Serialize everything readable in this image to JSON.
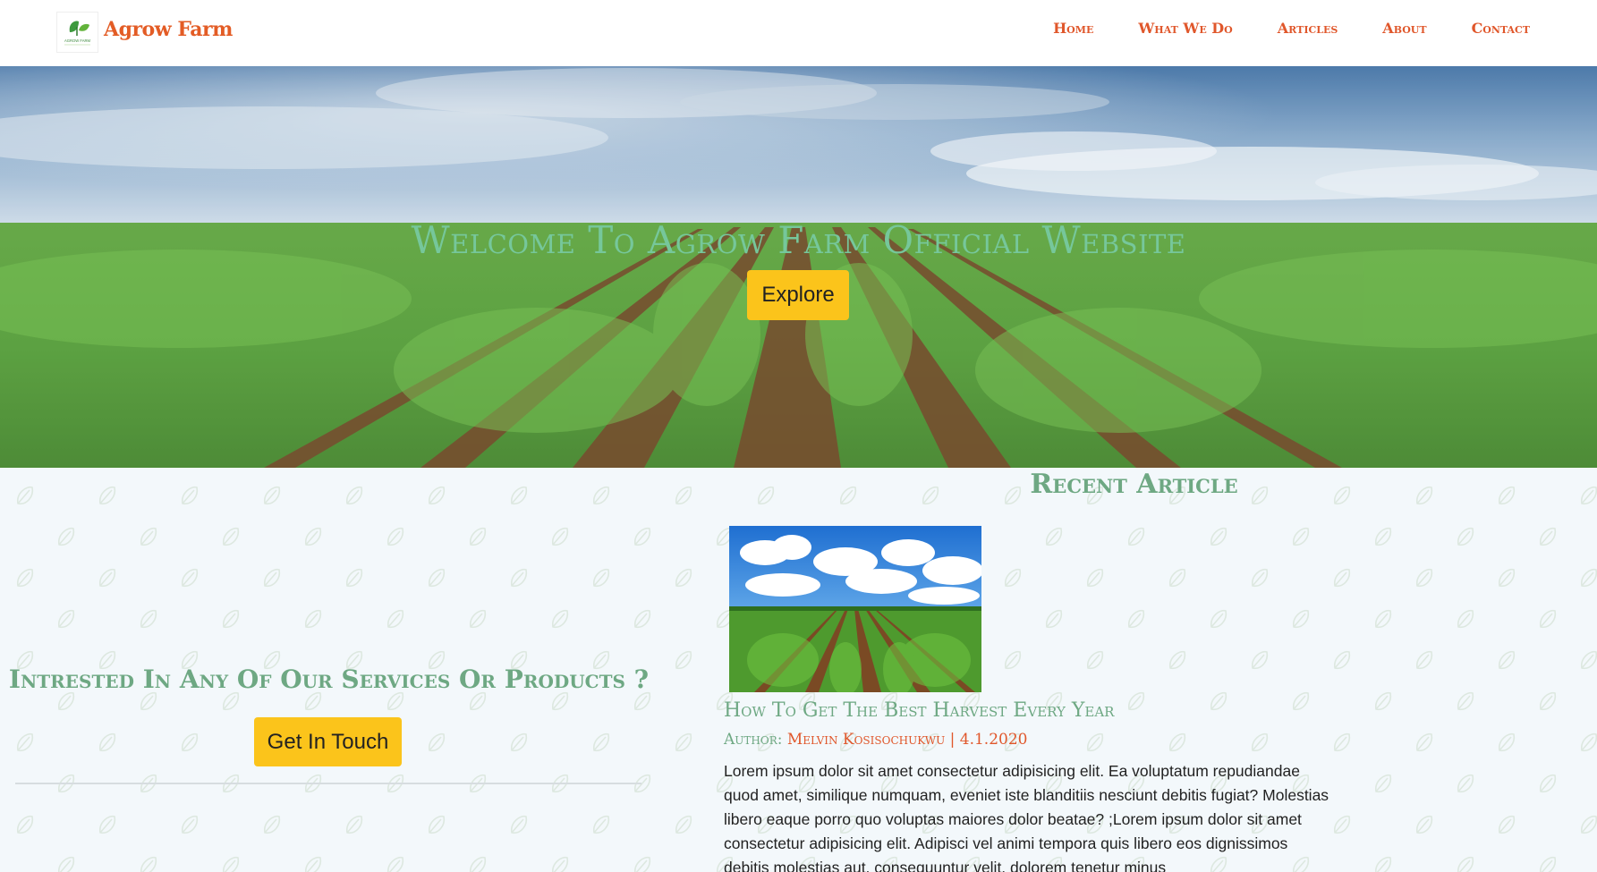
{
  "brand": {
    "name": "Agrow Farm",
    "logo_icon": "leaf-logo-icon",
    "logo_small_text": "AGROW FARM",
    "accent_color": "#e0572b"
  },
  "nav": {
    "items": [
      {
        "label": "Home"
      },
      {
        "label": "What We Do"
      },
      {
        "label": "Articles"
      },
      {
        "label": "About"
      },
      {
        "label": "Contact"
      }
    ]
  },
  "hero": {
    "title": "Welcome To Agrow Farm Official Website",
    "button_label": "Explore",
    "title_color": "#76c79b",
    "button_color": "#fbc41b"
  },
  "services": {
    "title": "Intrested In Any Of Our Services Or Products ?",
    "button_label": "Get In Touch"
  },
  "recent": {
    "section_title": "Recent Article",
    "article": {
      "title": "How To Get The Best Harvest Every Year",
      "author_label": "Author:",
      "author": "Melvin Kosisochukwu",
      "separator": "|",
      "date": "4.1.2020",
      "body": "Lorem ipsum dolor sit amet consectetur adipisicing elit. Ea voluptatum repudiandae quod amet, similique numquam, eveniet iste blanditiis nesciunt debitis fugiat? Molestias libero eaque porro quo voluptas maiores dolor beatae? ;Lorem ipsum dolor sit amet consectetur adipisicing elit. Adipisci vel animi tempora quis libero eos dignissimos debitis molestias aut, consequuntur velit, dolorem tenetur minus"
    }
  }
}
